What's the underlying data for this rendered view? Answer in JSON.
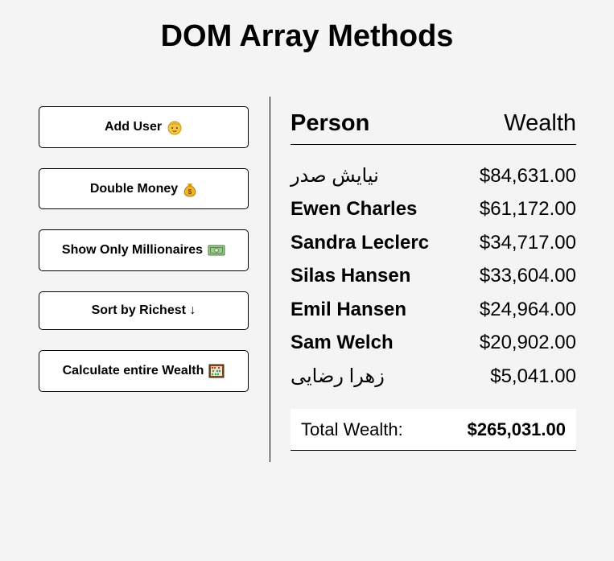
{
  "page": {
    "title": "DOM Array Methods"
  },
  "buttons": [
    {
      "label": "Add User",
      "icon": "person-emoji-icon"
    },
    {
      "label": "Double Money",
      "icon": "money-bag-icon"
    },
    {
      "label": "Show Only Millionaires",
      "icon": "banknote-icon"
    },
    {
      "label": "Sort by Richest ↓",
      "icon": ""
    },
    {
      "label": "Calculate entire Wealth",
      "icon": "abacus-icon"
    }
  ],
  "table": {
    "headers": {
      "person": "Person",
      "wealth": "Wealth"
    },
    "rows": [
      {
        "name": "نیایش صدر",
        "wealth": "$84,631.00"
      },
      {
        "name": "Ewen Charles",
        "wealth": "$61,172.00"
      },
      {
        "name": "Sandra Leclerc",
        "wealth": "$34,717.00"
      },
      {
        "name": "Silas Hansen",
        "wealth": "$33,604.00"
      },
      {
        "name": "Emil Hansen",
        "wealth": "$24,964.00"
      },
      {
        "name": "Sam Welch",
        "wealth": "$20,902.00"
      },
      {
        "name": "زهرا رضایی",
        "wealth": "$5,041.00"
      }
    ],
    "total": {
      "label": "Total Wealth:",
      "value": "$265,031.00"
    }
  }
}
